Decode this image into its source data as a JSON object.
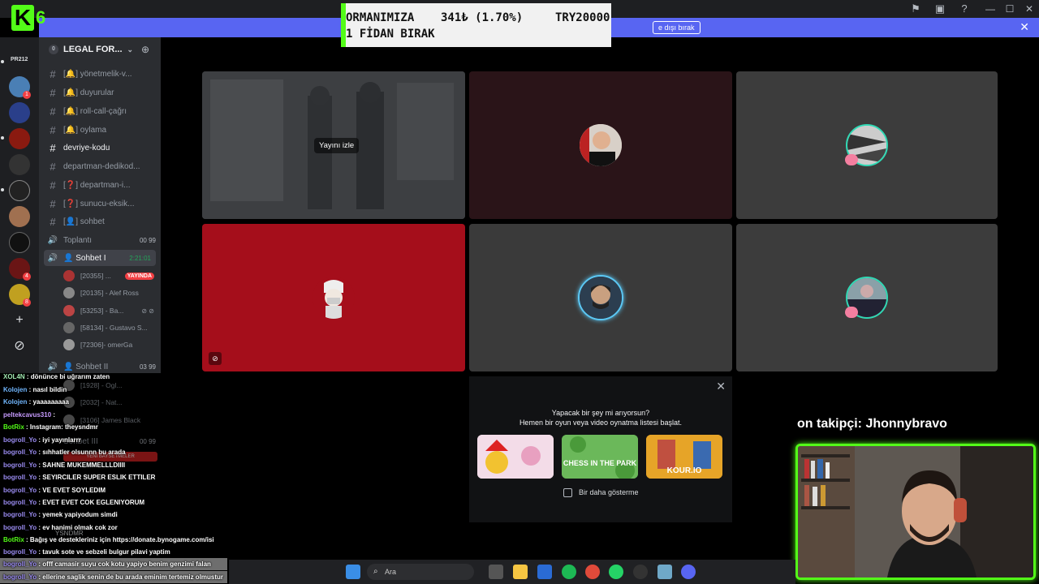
{
  "donation": {
    "line1_left": "ORMANIMIZA",
    "line1_mid": "341₺ (1.70%)",
    "line1_right": "TRY20000",
    "line2": "1 FİDAN BIRAK"
  },
  "logo": {
    "k": "K",
    "six": "6"
  },
  "banner": {
    "button_label": "e dışı bırak",
    "close": "✕"
  },
  "titlebar": {
    "icons": [
      "⚑",
      "▣",
      "?"
    ],
    "controls": [
      "—",
      "☐",
      "✕"
    ]
  },
  "rail": {
    "label_top": "PR212",
    "badges": [
      "1",
      "4",
      "8"
    ],
    "add": "+",
    "explore": "⊘"
  },
  "sidebar": {
    "server_name": "LEGAL FOR...",
    "server_badge": "0",
    "channels": [
      {
        "icon": "#",
        "label": "[🔔] yönetmelik-v..."
      },
      {
        "icon": "#",
        "label": "[🔔] duyurular"
      },
      {
        "icon": "#",
        "label": "[🔔] roll-call-çağrı"
      },
      {
        "icon": "#",
        "label": "[🔔] oylama"
      },
      {
        "icon": "#",
        "label": "devriye-kodu"
      },
      {
        "icon": "#",
        "label": "departman-dedikod..."
      },
      {
        "icon": "#",
        "label": "[❓] departman-i..."
      },
      {
        "icon": "#",
        "label": "[❓] sunucu-eksik..."
      },
      {
        "icon": "#",
        "label": "[👤] sohbet"
      },
      {
        "icon": "🔊",
        "label": "Toplantı",
        "meta": "00  99"
      },
      {
        "icon": "🔊",
        "label": "👤 Sohbet I",
        "meta": "2:21:01"
      }
    ],
    "users": [
      {
        "name": "[20355] ...",
        "badge": "YAYINDA"
      },
      {
        "name": "[20135] - Alef Ross"
      },
      {
        "name": "[53253] - Ba..."
      },
      {
        "name": "[58134] - Gustavo S..."
      },
      {
        "name": "[72306]- omerGa"
      }
    ],
    "channel2": {
      "label": "👤 Sohbet II",
      "meta": "03  99"
    },
    "users2": [
      {
        "name": "[1928] - Ogl..."
      },
      {
        "name": "[2032] - Nat..."
      },
      {
        "name": "[3106] James Black"
      }
    ],
    "channel3": {
      "label": "Sohbet III",
      "meta": "00  99"
    },
    "footer_btn": "YENİ BAYSETMELER",
    "footer_user": "YSNDMR"
  },
  "video": {
    "watch_label": "Yayını izle"
  },
  "activity": {
    "close": "✕",
    "title": "Yapacak bir şey mi arıyorsun?",
    "subtitle": "Hemen bir oyun veya video oynatma listesi başlat.",
    "games": [
      "",
      "CHESS IN THE PARK",
      "KOUR.IO"
    ],
    "checkbox_label": "Bir daha gösterme"
  },
  "chat": [
    {
      "user": "XOL4N",
      "text": " : dönünce bi uğrarım zaten",
      "cls": "g"
    },
    {
      "user": "Kolojen",
      "text": " : nasıl bildin",
      "cls": "c",
      "dot": true
    },
    {
      "user": "Kolojen",
      "text": " : yaaaaaaaaa",
      "cls": "c",
      "dot": true
    },
    {
      "user": "peltekcavus310",
      "text": " : ",
      "cls": ""
    },
    {
      "user": "BotRix",
      "text": " : Instagram: theysndmr",
      "cls": "bot",
      "badge": true
    },
    {
      "user": "bogroll_Yo",
      "text": " : iyi yayınlarrr",
      "cls": ""
    },
    {
      "user": "bogroll_Yo",
      "text": " : sıhhatler olsunnn bu arada",
      "cls": ""
    },
    {
      "user": "bogroll_Yo",
      "text": " : SAHNE MUKEMMELLLDIIII",
      "cls": ""
    },
    {
      "user": "bogroll_Yo",
      "text": " : SEYIRCILER SUPER ESLIK ETTILER",
      "cls": ""
    },
    {
      "user": "bogroll_Yo",
      "text": " : VE EVET SOYLEDIM",
      "cls": ""
    },
    {
      "user": "bogroll_Yo",
      "text": " : EVET EVET COK EGLENIYORUM",
      "cls": ""
    },
    {
      "user": "bogroll_Yo",
      "text": " : yemek yapiyodum simdi",
      "cls": ""
    },
    {
      "user": "bogroll_Yo",
      "text": " : ev hanimi olmak cok zor",
      "cls": ""
    },
    {
      "user": "BotRix",
      "text": " : Bağış ve destekleriniz için https://donate.bynogame.com/isi",
      "cls": "bot",
      "badge": true
    },
    {
      "user": "bogroll_Yo",
      "text": " : tavuk sote ve sebzeli bulgur pilavi yaptim",
      "cls": ""
    },
    {
      "user": "bogroll_Yo",
      "text": " : offf camasir suyu cok kotu yapiyo benim genzimi falan",
      "cls": ""
    },
    {
      "user": "bogroll_Yo",
      "text": " : ellerine saglik senin de bu arada eminim tertemiz olmustur",
      "cls": ""
    }
  ],
  "follower": "on takipçi: Jhonnybravo",
  "taskbar": {
    "search_placeholder": "Ara"
  },
  "colors": {
    "kick_green": "#53fc18",
    "discord_blurple": "#5865f2",
    "live_red": "#f23f43"
  }
}
